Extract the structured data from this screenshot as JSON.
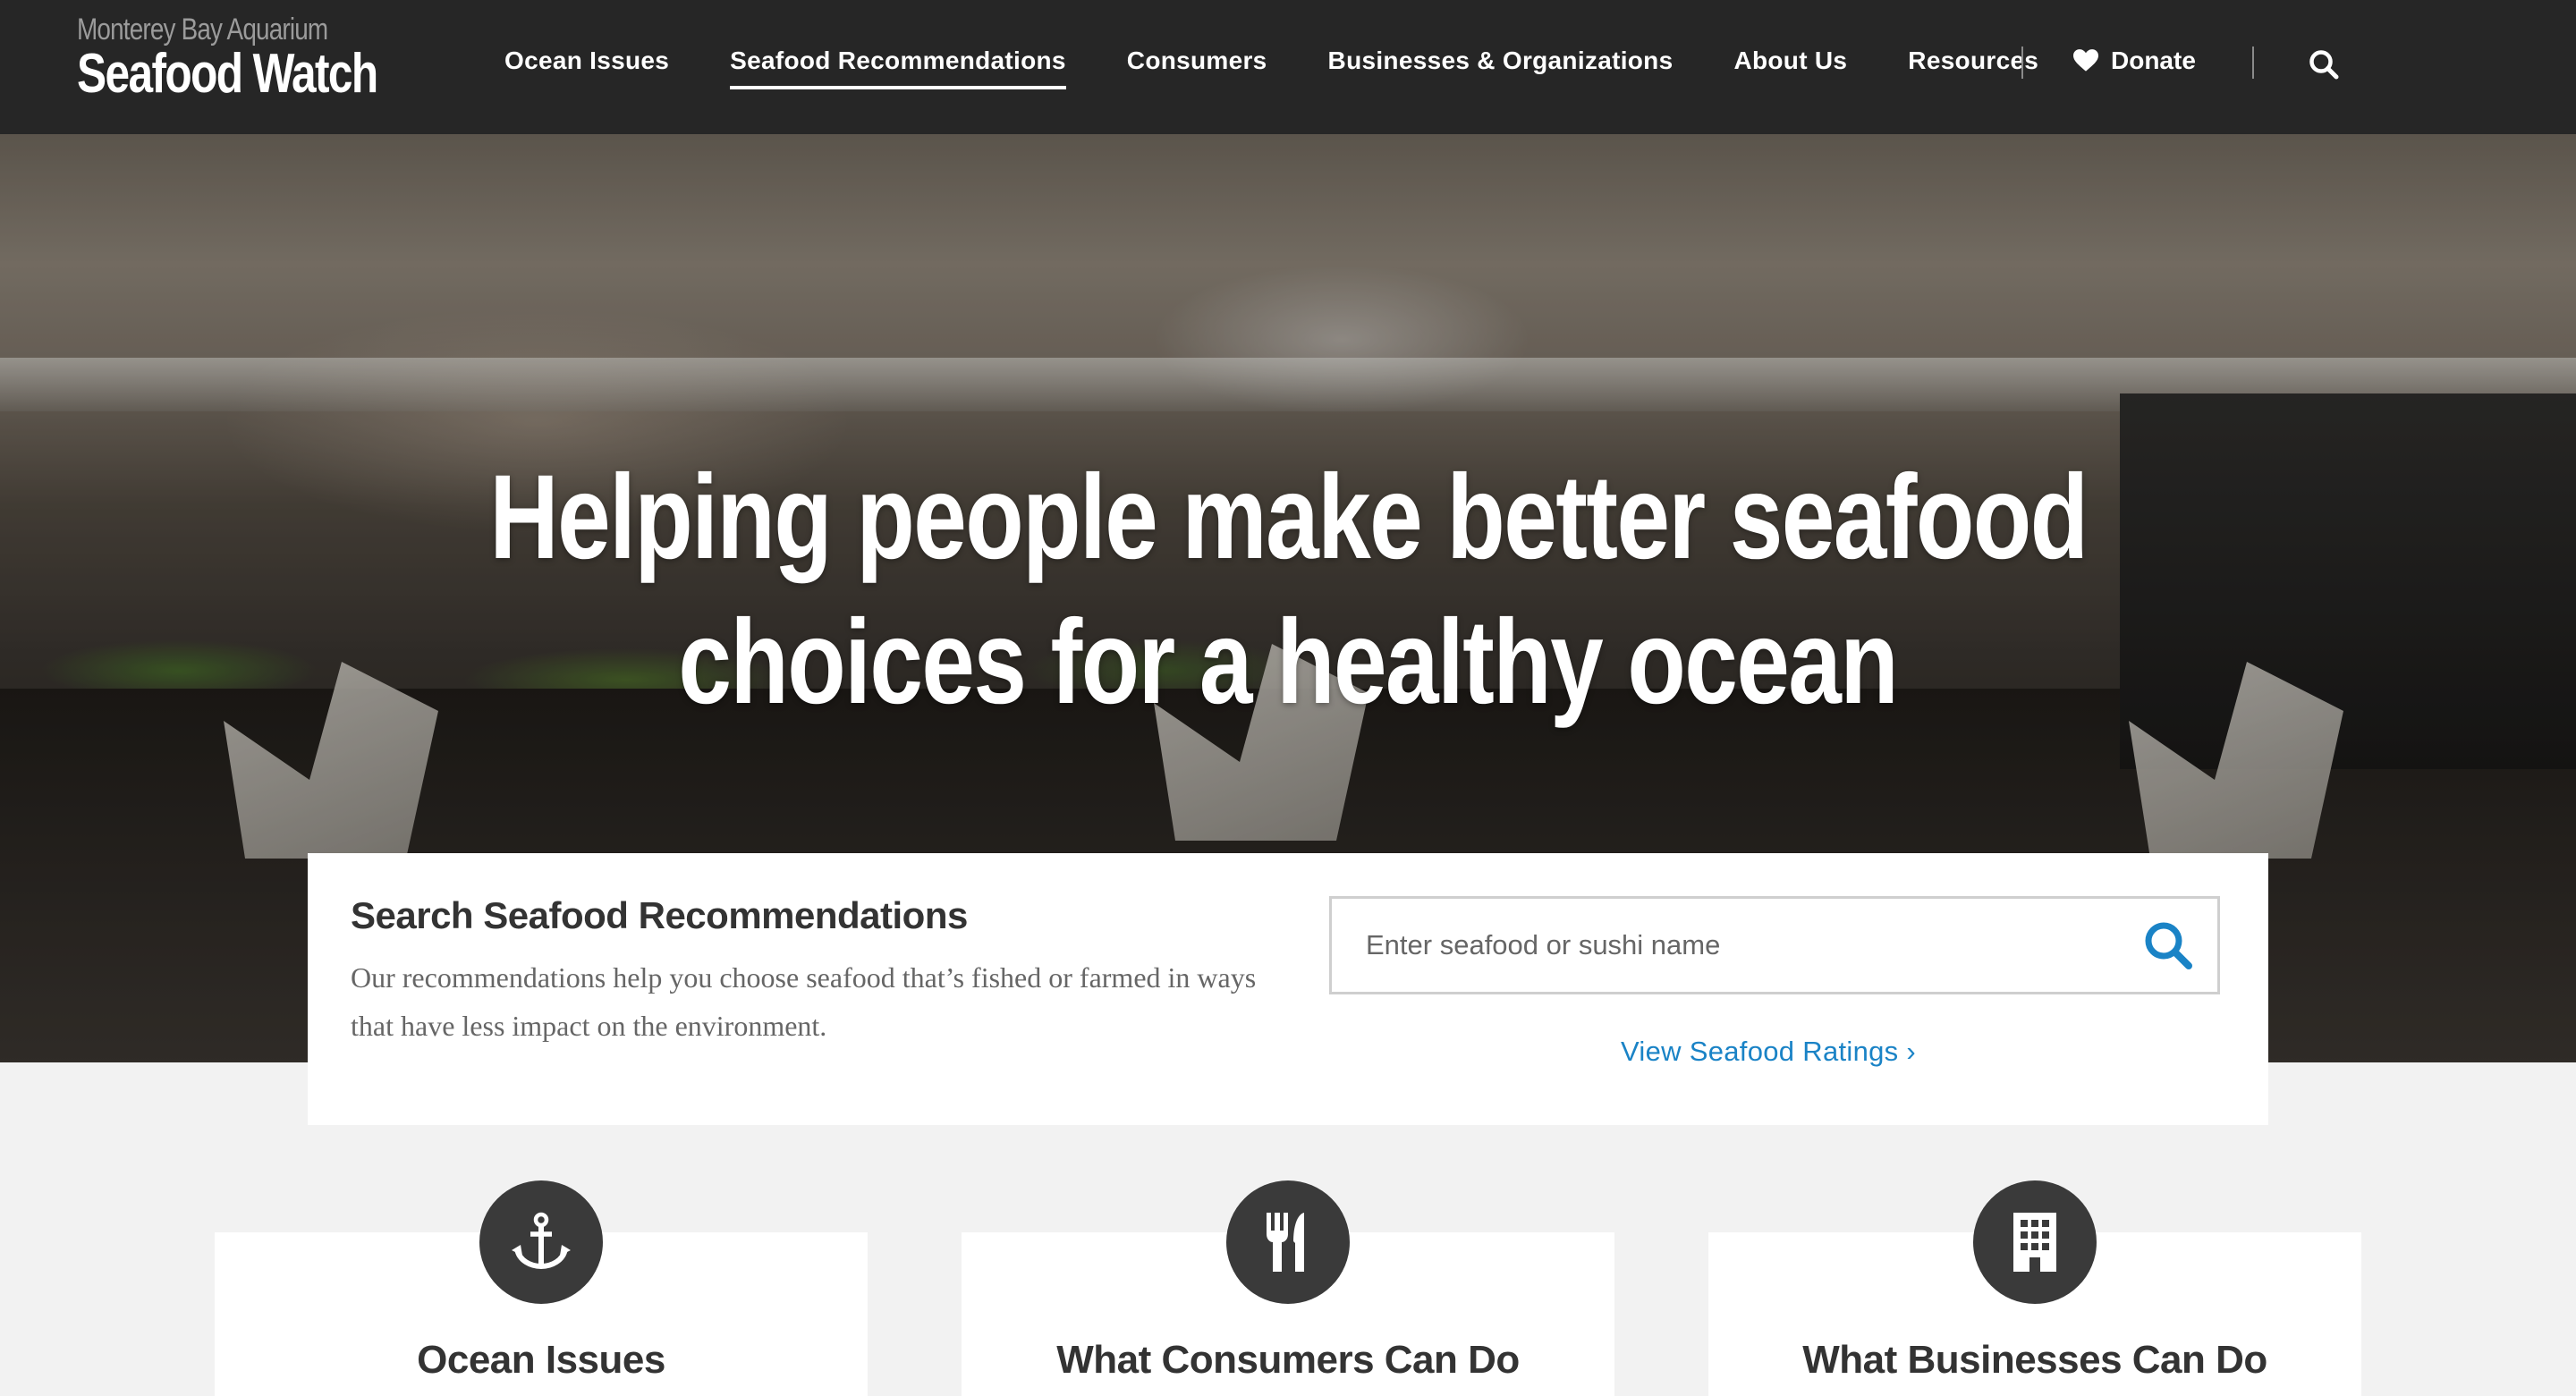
{
  "header": {
    "logo_top": "Monterey Bay Aquarium",
    "logo_main": "Seafood Watch",
    "nav": [
      {
        "label": "Ocean Issues",
        "active": false
      },
      {
        "label": "Seafood Recommendations",
        "active": true
      },
      {
        "label": "Consumers",
        "active": false
      },
      {
        "label": "Businesses & Organizations",
        "active": false
      },
      {
        "label": "About Us",
        "active": false
      },
      {
        "label": "Resources",
        "active": false
      }
    ],
    "donate_label": "Donate",
    "search_icon": "search-icon",
    "donate_icon": "heart-icon"
  },
  "hero": {
    "title_line1": "Helping people make better seafood",
    "title_line2": "choices for a healthy ocean"
  },
  "search": {
    "heading": "Search Seafood Recommendations",
    "description": "Our recommendations help you choose seafood that’s fished or farmed in ways that have less impact on the environment.",
    "placeholder": "Enter seafood or sushi name",
    "ratings_link": "View Seafood Ratings",
    "ratings_chevron": "›"
  },
  "cards": [
    {
      "title": "Ocean Issues",
      "icon": "anchor-icon"
    },
    {
      "title": "What Consumers Can Do",
      "icon": "fork-knife-icon"
    },
    {
      "title": "What Businesses Can Do",
      "icon": "building-icon"
    }
  ],
  "colors": {
    "header_bg": "#262626",
    "link_blue": "#1a83c6",
    "icon_circle": "#3a3a3a",
    "page_bg": "#f2f2f2"
  }
}
